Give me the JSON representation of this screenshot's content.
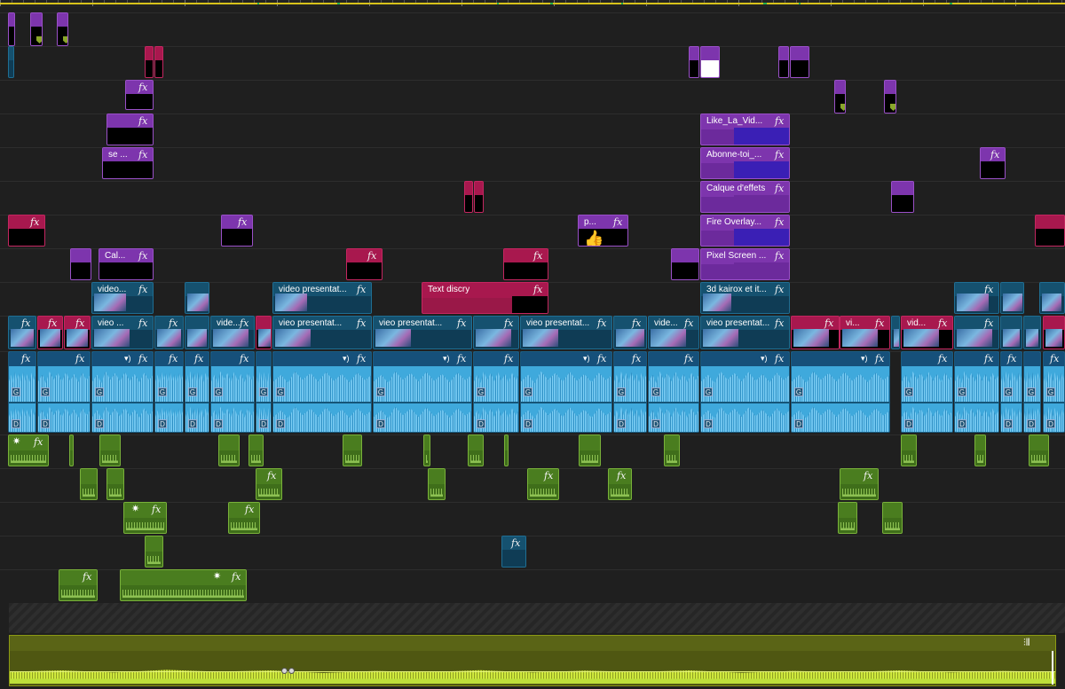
{
  "app": {
    "accent": "#d8c21a",
    "colors": {
      "purple": "#7d35ad",
      "red": "#a8184e",
      "video_blue": "#15516f",
      "audio_blue": "#3fa9dc",
      "audio_green": "#4a7d1f",
      "master": "#5a6416"
    }
  },
  "labels": {
    "fx": "fx",
    "channel_G": "G",
    "channel_D": "D",
    "star": "✷",
    "mic": "🔊",
    "waveform_icon": "waveform-icon"
  },
  "clips": {
    "like": "Like_La_Vid...",
    "abonne": "Abonne-toi_...",
    "calque": "Calque d'effets",
    "fire": "Fire Overlay...",
    "pixel": "Pixel Screen ...",
    "kairox": "3d kairox et it...",
    "se": "se ...",
    "cal": "Cal...",
    "p": "p...",
    "text_discry": "Text discry",
    "video1": "video...",
    "video_pres": "video presentat...",
    "vieo1": "vieo ...",
    "vieo_pres": "vieo presentat...",
    "vide": "vide...",
    "vi": "vi...",
    "vid": "vid..."
  }
}
